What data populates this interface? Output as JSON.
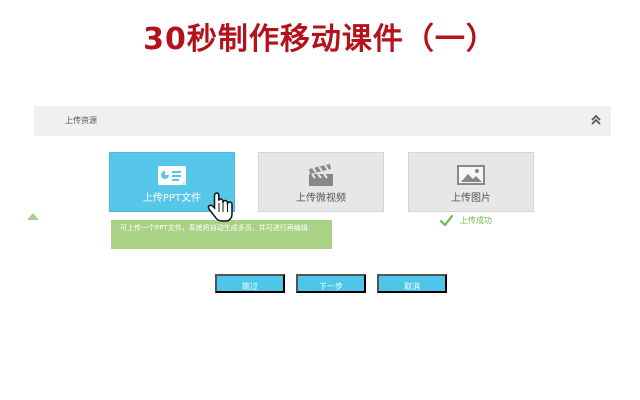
{
  "slide": {
    "title": "30秒制作移动课件（一）"
  },
  "upload_panel": {
    "label": "上传资源",
    "collapse_icon": "double-chevron-up-icon"
  },
  "upload_options": [
    {
      "label": "上传PPT文件",
      "icon": "presentation-file-icon",
      "state": "selected"
    },
    {
      "label": "上传微视频",
      "icon": "clapperboard-icon",
      "state": "default"
    },
    {
      "label": "上传图片",
      "icon": "image-icon",
      "state": "default"
    }
  ],
  "tooltip": {
    "text": "可上传一个PPT文件，系统将自动生成多页，并可进行再编辑"
  },
  "status": {
    "success_label": "上传成功",
    "success_icon": "checkmark-icon"
  },
  "actions": {
    "skip": "跳过",
    "next": "下一步",
    "cancel": "取消"
  },
  "colors": {
    "title": "#b3121a",
    "accent": "#4dc6ea",
    "tooltip": "#a8d386",
    "success": "#70ba4e"
  }
}
